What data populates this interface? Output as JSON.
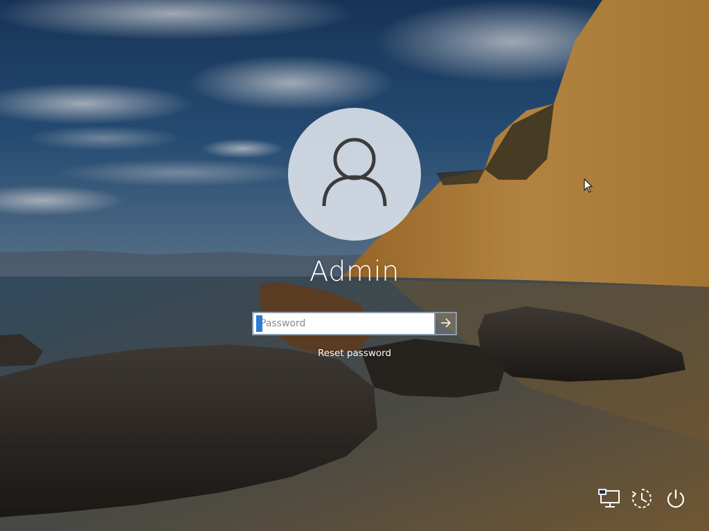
{
  "login": {
    "user_name": "Admin",
    "password_placeholder": "Password",
    "password_value": "",
    "reset_link": "Reset password"
  },
  "icons": {
    "avatar": "user-silhouette-icon",
    "submit": "arrow-right-icon",
    "network": "network-icon",
    "ease_of_access": "ease-of-access-icon",
    "power": "power-icon"
  },
  "colors": {
    "avatar_bg": "#d6dee6",
    "input_border": "#8f9cab",
    "caret": "#2c7bd6",
    "text": "#ffffff"
  }
}
